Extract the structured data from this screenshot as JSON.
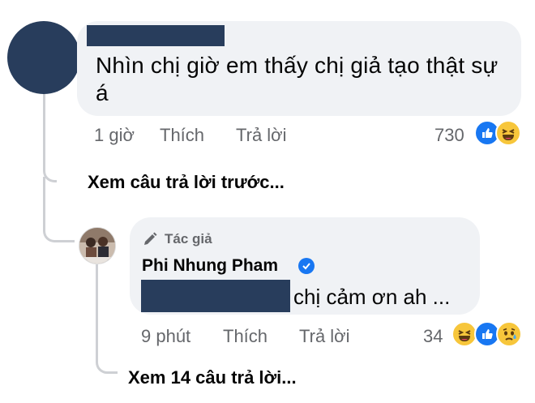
{
  "comment1": {
    "text": "Nhìn chị giờ em thấy chị giả tạo thật sự á",
    "time": "1 giờ",
    "like_label": "Thích",
    "reply_label": "Trả lời",
    "reaction_count": "730",
    "reactions": [
      "like-icon",
      "haha-icon"
    ]
  },
  "view_previous": "Xem câu trả lời trước...",
  "reply": {
    "author_badge": "Tác giả",
    "author_name": "Phi Nhung Pham",
    "text": "chị cảm ơn ah ...",
    "time": "9 phút",
    "like_label": "Thích",
    "reply_label": "Trả lời",
    "reaction_count": "34",
    "reactions": [
      "haha-icon",
      "like-icon",
      "sad-icon"
    ]
  },
  "view_replies": "Xem 14 câu trả lời...",
  "colors": {
    "redaction": "#283d5c",
    "bubble": "#f0f2f5",
    "like_blue": "#1877f2",
    "emoji_yellow": "#f7c63b",
    "meta_gray": "#65676b"
  }
}
